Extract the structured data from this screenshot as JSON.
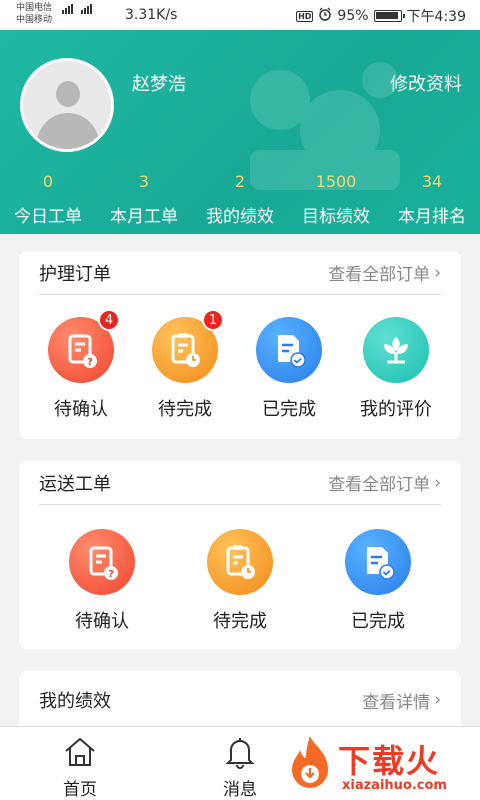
{
  "status_bar": {
    "carrier1": "中国电信",
    "carrier2": "中国移动",
    "net1": "2G",
    "net2": "4G",
    "speed": "3.31K/s",
    "hd": "HD",
    "battery": "95%",
    "time": "下午4:39"
  },
  "profile": {
    "name": "赵梦浩",
    "edit_label": "修改资料",
    "stats": [
      {
        "value": "0",
        "label": "今日工单"
      },
      {
        "value": "3",
        "label": "本月工单"
      },
      {
        "value": "2",
        "label": "我的绩效"
      },
      {
        "value": "1500",
        "label": "目标绩效"
      },
      {
        "value": "34",
        "label": "本月排名"
      }
    ]
  },
  "nursing_orders": {
    "title": "护理订单",
    "link": "查看全部订单",
    "items": [
      {
        "label": "待确认",
        "badge": "4",
        "icon": "pending-confirm-icon",
        "color": "#f0452e"
      },
      {
        "label": "待完成",
        "badge": "1",
        "icon": "pending-complete-icon",
        "color": "#f28a19"
      },
      {
        "label": "已完成",
        "icon": "completed-icon",
        "color": "#2a7ee8"
      },
      {
        "label": "我的评价",
        "icon": "review-flower-icon",
        "color": "#1cbfae"
      }
    ]
  },
  "transport_orders": {
    "title": "运送工单",
    "link": "查看全部订单",
    "items": [
      {
        "label": "待确认",
        "icon": "pending-confirm-icon"
      },
      {
        "label": "待完成",
        "icon": "pending-complete-icon"
      },
      {
        "label": "已完成",
        "icon": "completed-icon"
      }
    ]
  },
  "performance": {
    "title": "我的绩效",
    "link": "查看详情"
  },
  "bottom_nav": {
    "home": "首页",
    "messages": "消息"
  },
  "watermark": {
    "cn": "下载火",
    "en": "xiazaihuo.com"
  }
}
